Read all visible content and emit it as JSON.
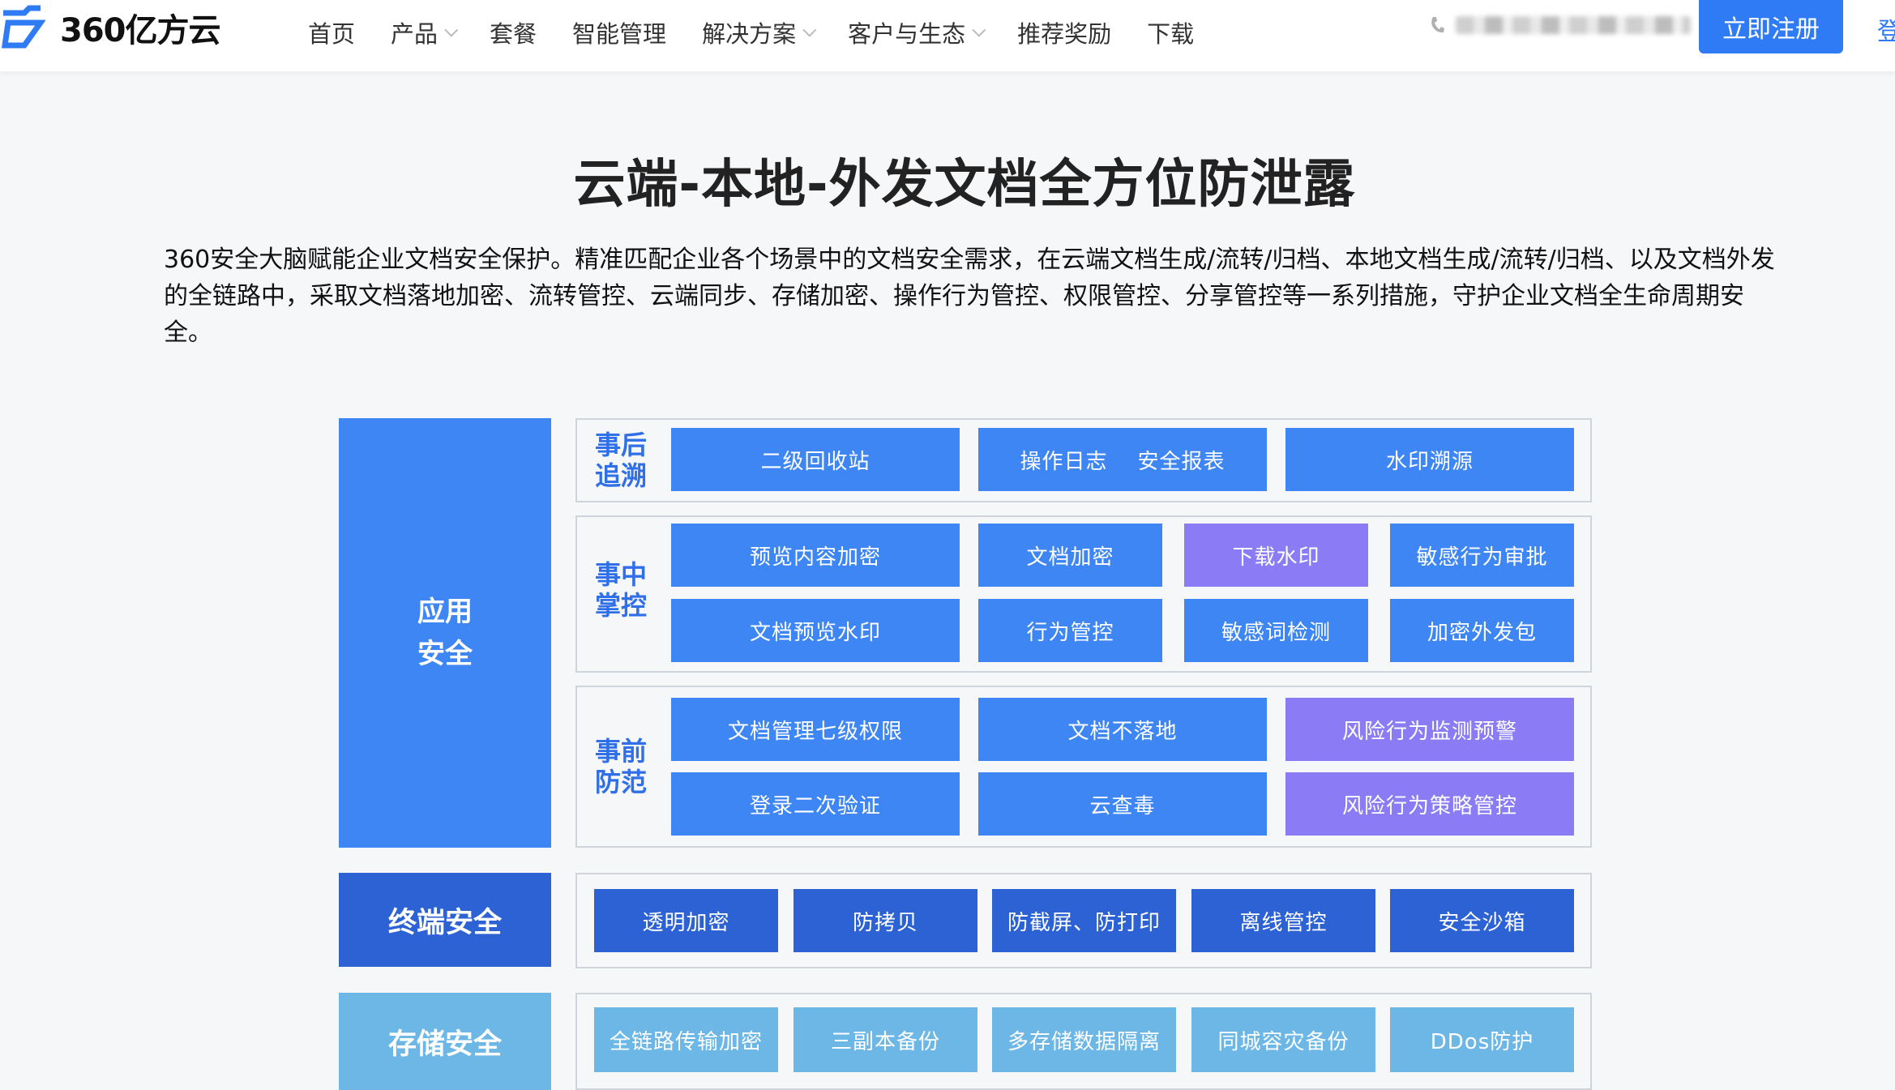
{
  "brand": {
    "name": "360亿方云"
  },
  "nav": {
    "items": [
      {
        "label": "首页",
        "dropdown": false
      },
      {
        "label": "产品",
        "dropdown": true
      },
      {
        "label": "套餐",
        "dropdown": false
      },
      {
        "label": "智能管理",
        "dropdown": false
      },
      {
        "label": "解决方案",
        "dropdown": true
      },
      {
        "label": "客户与生态",
        "dropdown": true
      },
      {
        "label": "推荐奖励",
        "dropdown": false
      },
      {
        "label": "下载",
        "dropdown": false
      }
    ],
    "register_label": "立即注册",
    "login_label": "登"
  },
  "colors": {
    "primary": "#2f7bf5",
    "tile_blue": "#3f86f5",
    "tile_purple": "#8b7cf5",
    "tile_dark": "#2c62d4",
    "tile_light": "#6cb7e6"
  },
  "heading": {
    "title": "云端-本地-外发文档全方位防泄露",
    "description": "360安全大脑赋能企业文档安全保护。精准匹配企业各个场景中的文档安全需求，在云端文档生成/流转/归档、本地文档生成/流转/归档、以及文档外发的全链路中，采取文档落地加密、流转管控、云端同步、存储加密、操作行为管控、权限管控、分享管控等一系列措施，守护企业文档全生命周期安全。"
  },
  "diagram": {
    "categories": {
      "app": "应用\n安全",
      "terminal": "终端安全",
      "storage": "存储安全"
    },
    "stages": {
      "after": "事后\n追溯",
      "during": "事中\n掌控",
      "before": "事前\n防范"
    },
    "after_tiles": [
      "二级回收站",
      "操作日志    安全报表",
      "水印溯源"
    ],
    "during_tiles": [
      "预览内容加密",
      "文档加密",
      "下载水印",
      "敏感行为审批",
      "文档预览水印",
      "行为管控",
      "敏感词检测",
      "加密外发包"
    ],
    "before_tiles": [
      "文档管理七级权限",
      "文档不落地",
      "风险行为监测预警",
      "登录二次验证",
      "云查毒",
      "风险行为策略管控"
    ],
    "terminal_tiles": [
      "透明加密",
      "防拷贝",
      "防截屏、防打印",
      "离线管控",
      "安全沙箱"
    ],
    "storage_tiles": [
      "全链路传输加密",
      "三副本备份",
      "多存储数据隔离",
      "同城容灾备份",
      "DDos防护"
    ]
  }
}
